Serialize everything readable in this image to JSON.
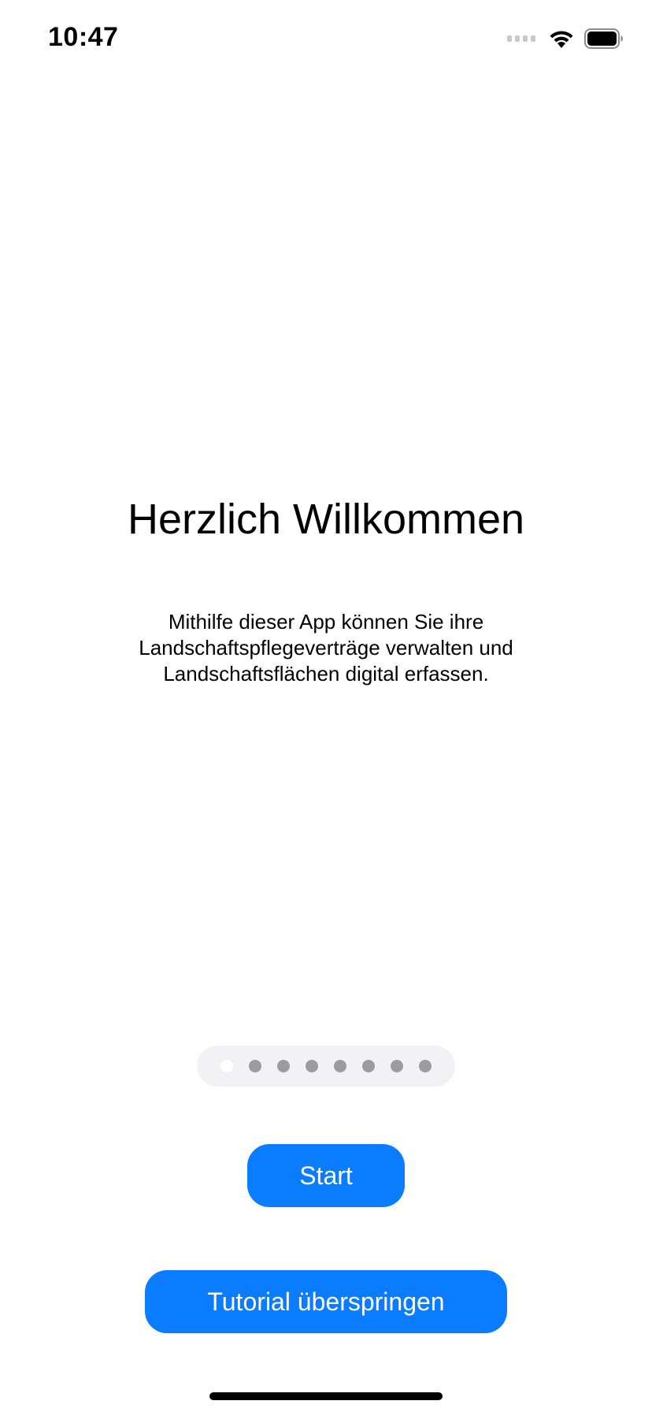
{
  "status_bar": {
    "time": "10:47"
  },
  "onboarding": {
    "title": "Herzlich Willkommen",
    "description_lines": [
      "Mithilfe dieser App können Sie ihre",
      "Landschaftspflegeverträge verwalten und",
      "Landschaftsflächen digital erfassen."
    ],
    "page_count": 8,
    "current_page": 1
  },
  "buttons": {
    "start_label": "Start",
    "skip_label": "Tutorial überspringen"
  },
  "colors": {
    "accent": "#0a7cff",
    "page_dot_inactive": "#9c9ca0",
    "page_dot_active": "#ffffff",
    "indicator_background": "#f2f2f4"
  }
}
